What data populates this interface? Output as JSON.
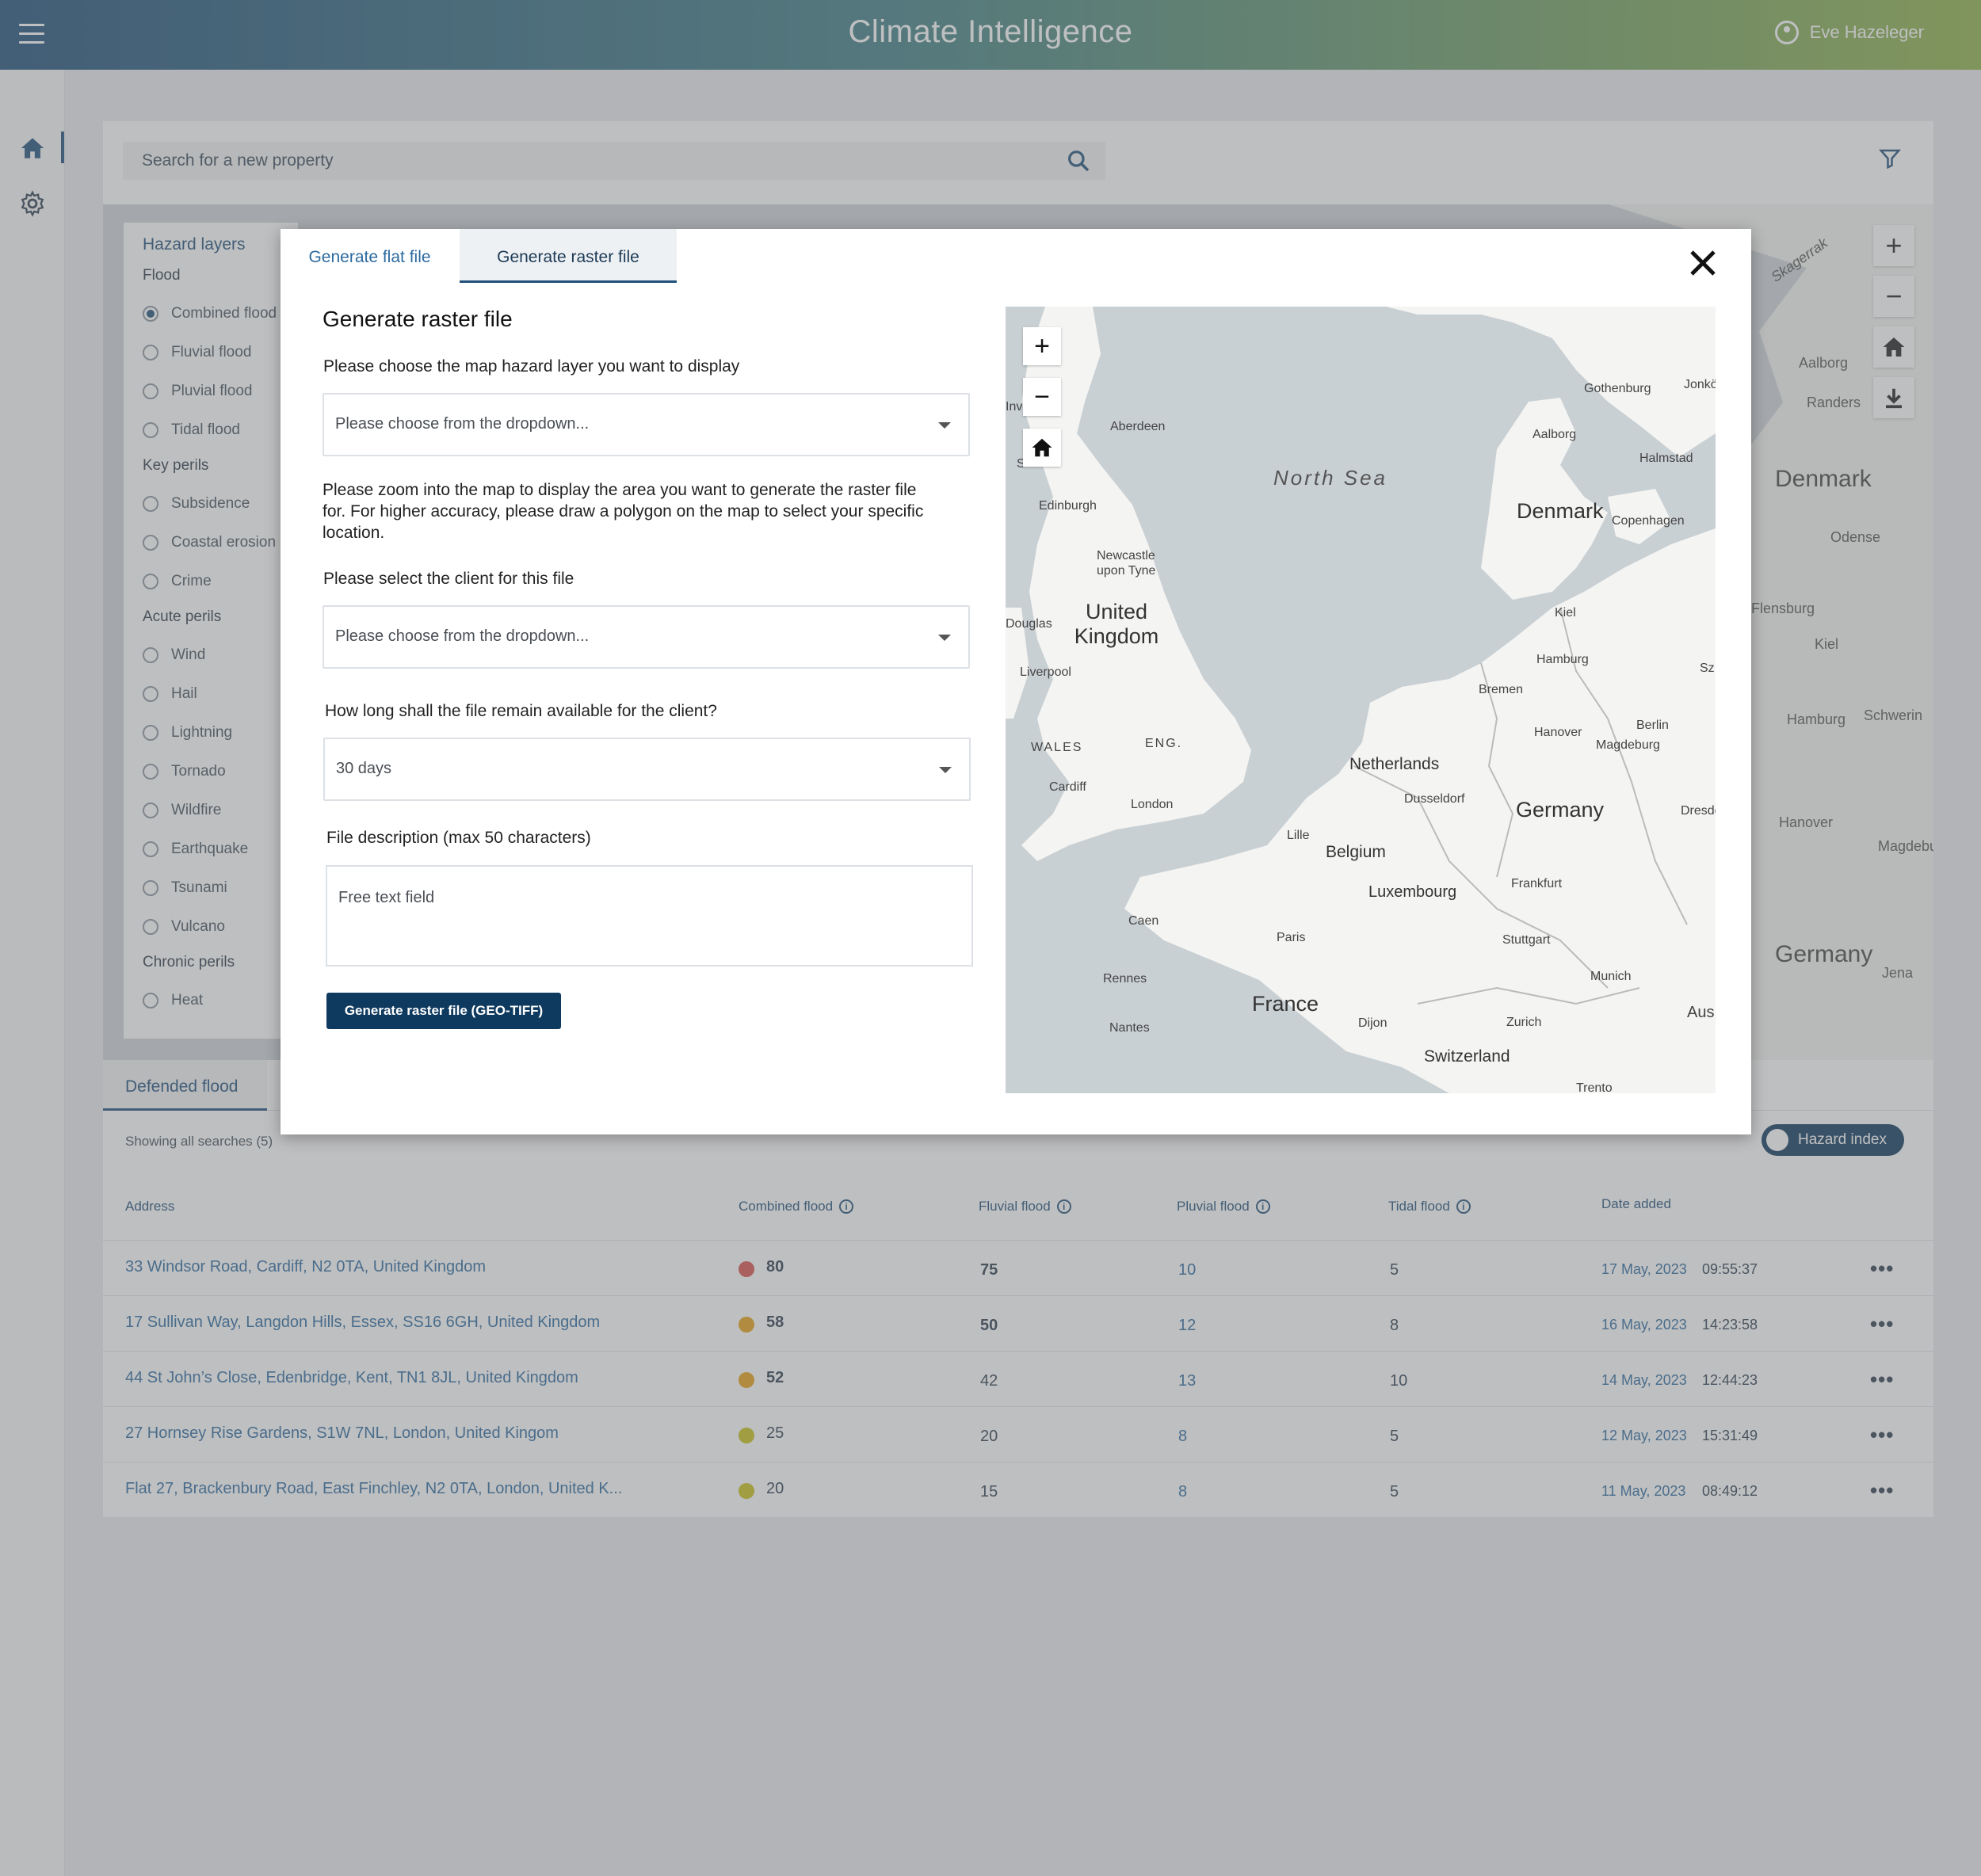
{
  "header": {
    "title": "Climate Intelligence",
    "user": "Eve Hazeleger"
  },
  "search": {
    "placeholder": "Search for a new property"
  },
  "hazard_panel": {
    "title": "Hazard layers",
    "groups": [
      {
        "label": "Flood",
        "items": [
          "Combined flood",
          "Fluvial flood",
          "Pluvial flood",
          "Tidal flood"
        ],
        "selected": "Combined flood"
      },
      {
        "label": "Key perils",
        "items": [
          "Subsidence",
          "Coastal erosion",
          "Crime"
        ]
      },
      {
        "label": "Acute perils",
        "items": [
          "Wind",
          "Hail",
          "Lightning",
          "Tornado",
          "Wildfire",
          "Earthquake",
          "Tsunami",
          "Vulcano"
        ]
      },
      {
        "label": "Chronic perils",
        "items": [
          "Heat"
        ]
      }
    ]
  },
  "bg_map": {
    "labels": [
      "Skagerrak",
      "Aalborg",
      "Randers",
      "Denmark",
      "Odense",
      "Flensburg",
      "Kiel",
      "Hamburg",
      "Schwerin",
      "Hanover",
      "Magdebu",
      "Germany",
      "Jena"
    ]
  },
  "bottom": {
    "tab": "Defended flood",
    "showing": "Showing all searches (5)",
    "toggle_label": "Hazard index",
    "columns": [
      "Address",
      "Combined flood",
      "Fluvial flood",
      "Pluvial flood",
      "Tidal flood",
      "Date added"
    ],
    "rows": [
      {
        "address": "33 Windsor Road, Cardiff, N2 0TA, United Kingdom",
        "combined": "80",
        "combined_color": "#d9534f",
        "fluvial": "75",
        "pluvial": "10",
        "tidal": "5",
        "date": "17 May, 2023",
        "time": "09:55:37"
      },
      {
        "address": "17 Sullivan Way, Langdon Hills, Essex, SS16 6GH, United Kingdom",
        "combined": "58",
        "combined_color": "#e8a317",
        "fluvial": "50",
        "pluvial": "12",
        "tidal": "8",
        "date": "16 May, 2023",
        "time": "14:23:58"
      },
      {
        "address": "44 St John’s Close, Edenbridge, Kent, TN1 8JL, United Kingdom",
        "combined": "52",
        "combined_color": "#e8a317",
        "fluvial": "42",
        "pluvial": "13",
        "tidal": "10",
        "date": "14 May, 2023",
        "time": "12:44:23"
      },
      {
        "address": "27 Hornsey Rise Gardens, S1W 7NL, London, United Kingom",
        "combined": "25",
        "combined_color": "#c8c21a",
        "fluvial": "20",
        "pluvial": "8",
        "tidal": "5",
        "date": "12 May, 2023",
        "time": "15:31:49"
      },
      {
        "address": "Flat 27, Brackenbury Road, East Finchley, N2 0TA, London, United K...",
        "combined": "20",
        "combined_color": "#c8c21a",
        "fluvial": "15",
        "pluvial": "8",
        "tidal": "5",
        "date": "11 May, 2023",
        "time": "08:49:12"
      }
    ],
    "more_label": "•••"
  },
  "modal": {
    "tabs": [
      "Generate flat file",
      "Generate raster file"
    ],
    "active_tab": "Generate raster file",
    "heading": "Generate raster file",
    "hazard_label": "Please choose the map hazard layer you want to display",
    "hazard_placeholder": "Please choose from the dropdown...",
    "zoom_text": "Please zoom into the map to display the area you want to generate the raster file for. For higher accuracy, please draw a polygon on the map to select your specific location.",
    "client_label": "Please select the client for this file",
    "client_placeholder": "Please choose from the dropdown...",
    "duration_label": "How long shall the file remain available for the client?",
    "duration_value": "30 days",
    "description_label": "File description (max 50 characters)",
    "description_placeholder": "Free text field",
    "button": "Generate raster file (GEO-TIFF)",
    "map": {
      "sea": "North Sea",
      "countries": [
        "United Kingdom",
        "Denmark",
        "Netherlands",
        "Belgium",
        "Germany",
        "Luxembourg",
        "France",
        "Switzerland"
      ],
      "cities": [
        "Aberdeen",
        "Edinburgh",
        "Newcastle upon Tyne",
        "Douglas",
        "Liverpool",
        "WALES",
        "ENG.",
        "Cardiff",
        "London",
        "Gothenburg",
        "Jonkö",
        "Aalborg",
        "Halmstad",
        "Copenhagen",
        "Kiel",
        "Hamburg",
        "Bremen",
        "Hanover",
        "Berlin",
        "Magdeburg",
        "Dusseldorf",
        "Dresde",
        "Lille",
        "Frankfurt",
        "Caen",
        "Paris",
        "Stuttgart",
        "Rennes",
        "Munich",
        "Nantes",
        "Dijon",
        "Zurich",
        "Aus",
        "Trento",
        "Inv",
        "Sz",
        "S"
      ]
    }
  }
}
